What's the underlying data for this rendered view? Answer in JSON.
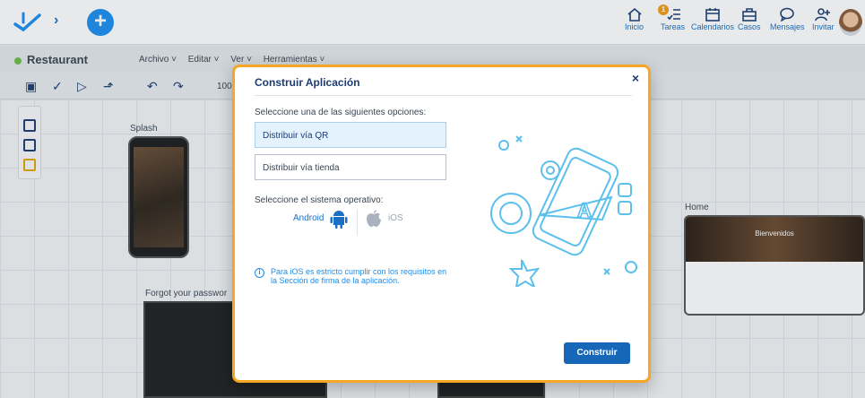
{
  "topbar": {
    "nav": [
      {
        "label": "Inicio",
        "icon": "home-icon"
      },
      {
        "label": "Tareas",
        "icon": "tasks-icon",
        "badge": "1"
      },
      {
        "label": "Calendarios",
        "icon": "calendar-icon"
      },
      {
        "label": "Casos",
        "icon": "briefcase-icon"
      },
      {
        "label": "Mensajes",
        "icon": "chat-icon"
      },
      {
        "label": "Invitar",
        "icon": "invite-user-icon"
      }
    ]
  },
  "editor": {
    "app_name": "Restaurant",
    "menus": [
      "Archivo ˅",
      "Editar ˅",
      "Ver ˅",
      "Herramientas ˅"
    ],
    "zoom": "100"
  },
  "canvas": {
    "splash_label": "Splash",
    "forgot_label": "Forgot your passwor",
    "home_label": "Home",
    "home_welcome": "Bienvenidos"
  },
  "modal": {
    "title": "Construir Aplicación",
    "close": "×",
    "options_prompt": "Seleccione una de las siguientes opciones:",
    "option_qr": "Distribuir vía QR",
    "option_store": "Distribuir vía tienda",
    "os_prompt": "Seleccione el sistema operativo:",
    "os_android": "Android",
    "os_ios": "iOS",
    "info_text": "Para iOS es estricto cumplir con los requisitos en la Sección de firma de la aplicación.",
    "build_button": "Construir"
  },
  "colors": {
    "accent": "#1a6fc4",
    "modal_border": "#f5a623",
    "button": "#1667b8"
  }
}
